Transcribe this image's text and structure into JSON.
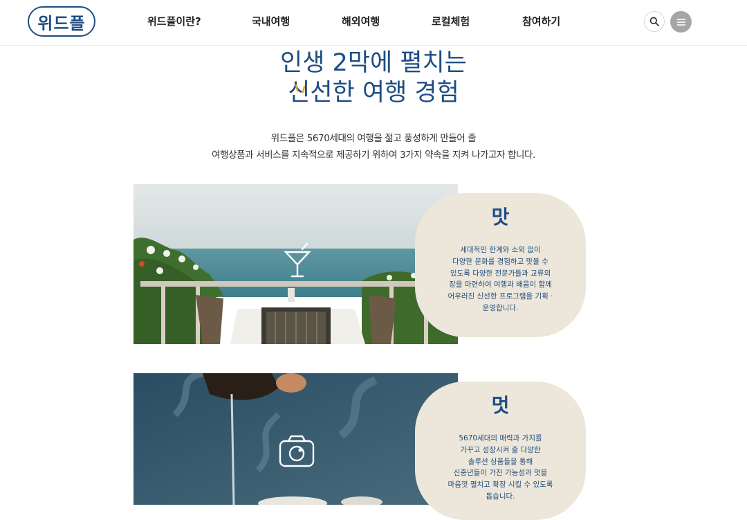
{
  "header": {
    "logo_text": "위드플",
    "nav": [
      {
        "label": "위드플이란?"
      },
      {
        "label": "국내여행"
      },
      {
        "label": "해외여행"
      },
      {
        "label": "로컬체험"
      },
      {
        "label": "참여하기"
      }
    ],
    "search_icon": "search-icon",
    "menu_icon": "hamburger-menu-icon"
  },
  "hero": {
    "headline_line1": "인생 2막에 펼치는",
    "headline_line2": "신선한 여행 경험",
    "intro_line1": "위드플은 5670세대의 여행을 젊고 풍성하게 만들어 줄",
    "intro_line2": "여행상품과 서비스를 지속적으로 제공하기 위하여 3가지 약속을 지켜 나가고자 합니다."
  },
  "promises": [
    {
      "title": "맛",
      "icon": "cocktail-glass-icon",
      "text": "세대적인 한계와 소외 없이\n다양한 문화를 경험하고 맛볼 수\n있도록 다양한 전문가들과 교류의\n장을 마련하여 여행과 배움이 함께\n어우러진 신선한 프로그램을 기획 ·\n운영합니다."
    },
    {
      "title": "멋",
      "icon": "camera-icon",
      "text": "5670세대의 매력과 가치를\n가꾸고 성장시켜 줄 다양한\n솔루션 상품들을 통해\n신중년들이 가진 가능성과 멋을\n마음껏 펼치고 확장 시킬 수 있도록\n돕습니다."
    }
  ],
  "colors": {
    "brand_navy": "#1d4d84",
    "accent_orange": "#f0a030",
    "blob_beige": "#ece7da"
  }
}
